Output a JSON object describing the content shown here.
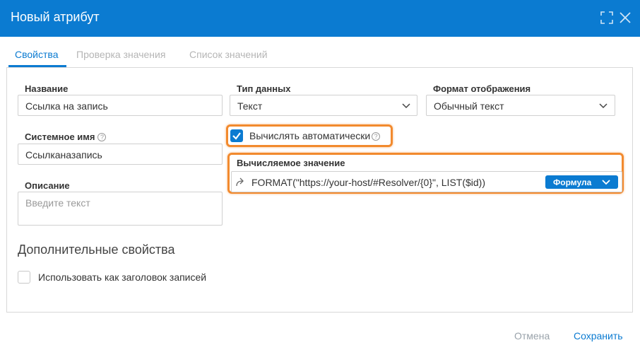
{
  "dialog": {
    "title": "Новый атрибут",
    "header_icons": [
      "expand-icon",
      "close-icon"
    ],
    "accent_color": "#0b7bd1",
    "highlight_color": "#f28a2e"
  },
  "tabs": [
    {
      "label": "Свойства",
      "active": true
    },
    {
      "label": "Проверка значения",
      "active": false
    },
    {
      "label": "Список значений",
      "active": false
    }
  ],
  "fields": {
    "name": {
      "label": "Название",
      "value": "Ссылка на запись"
    },
    "system_name": {
      "label": "Системное имя",
      "value": "Ссылканазапись",
      "help_icon": "?"
    },
    "description": {
      "label": "Описание",
      "placeholder": "Введите текст"
    },
    "data_type": {
      "label": "Тип данных",
      "value": "Текст"
    },
    "display_format": {
      "label": "Формат отображения",
      "value": "Обычный текст"
    },
    "auto_compute": {
      "label": "Вычислять автоматически",
      "checked": true,
      "help_icon": "?"
    },
    "computed_value": {
      "label": "Вычисляемое значение",
      "value": "FORMAT(\"https://your-host/#Resolver/{0}\", LIST($id))",
      "mode_button": "Формула"
    }
  },
  "extra": {
    "title": "Дополнительные свойства",
    "use_as_header": {
      "label": "Использовать как заголовок записей",
      "checked": false
    }
  },
  "footer": {
    "cancel_label": "Отмена",
    "save_label": "Сохранить"
  }
}
